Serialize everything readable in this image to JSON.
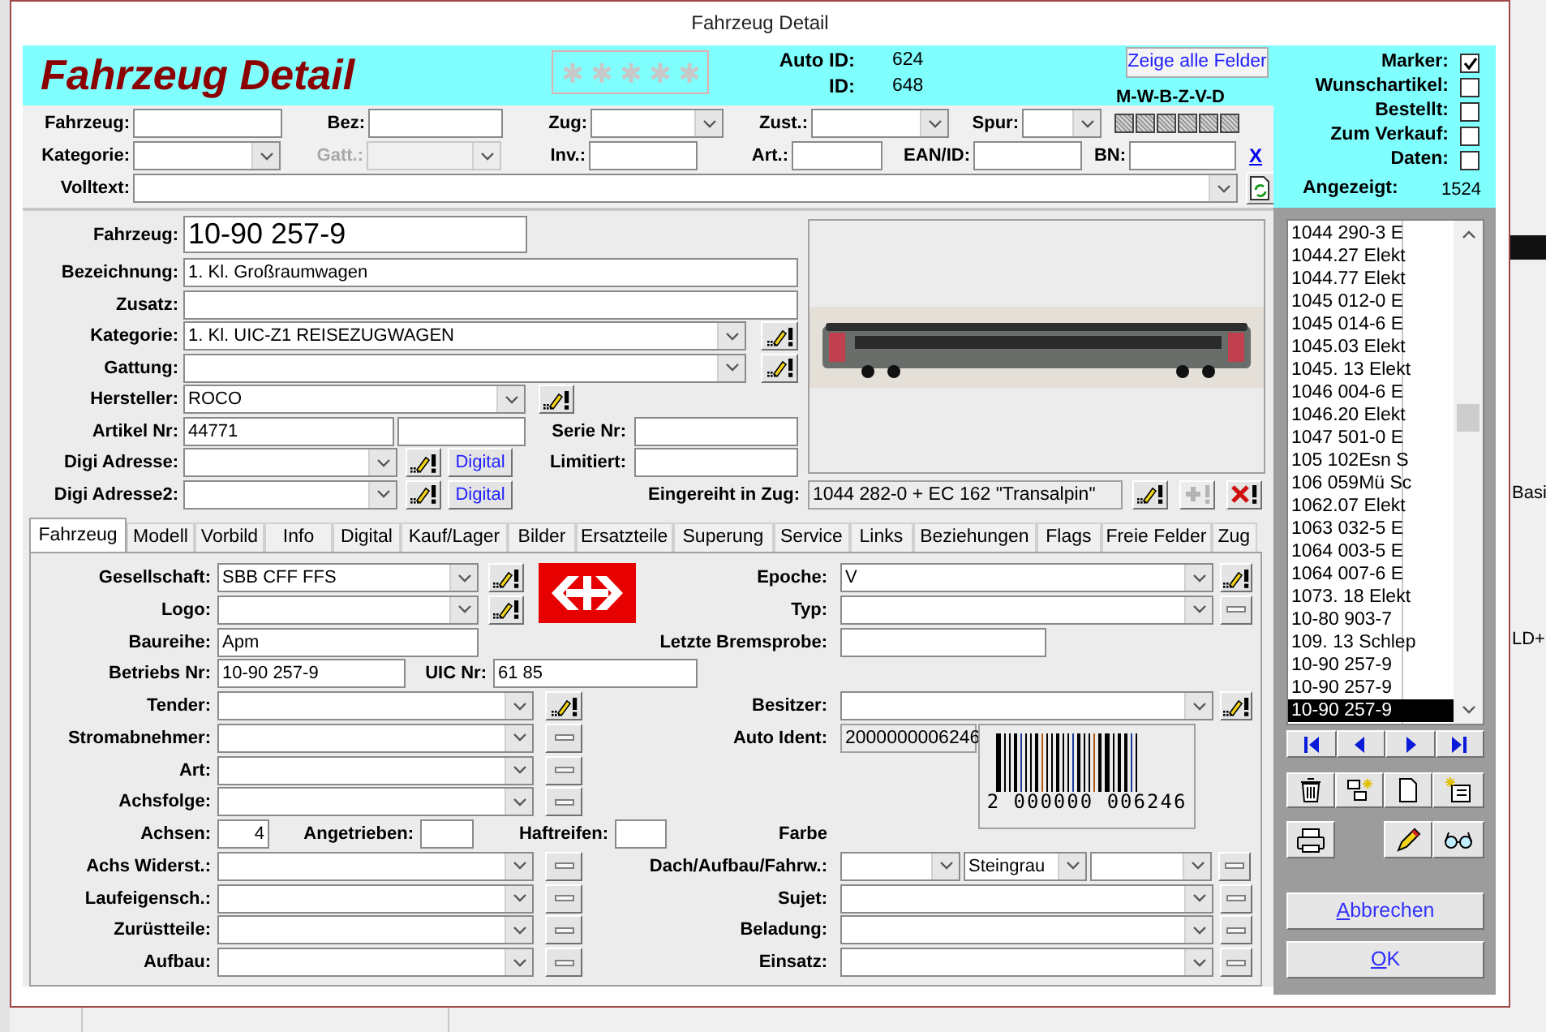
{
  "window": {
    "title": "Fahrzeug Detail"
  },
  "header": {
    "title": "Fahrzeug Detail",
    "stars": 0,
    "ids": [
      {
        "label": "Auto ID:",
        "value": "624"
      },
      {
        "label": "ID:",
        "value": "648"
      }
    ],
    "show_all_button": "Zeige alle Felder",
    "legend": "M-W-B-Z-V-D"
  },
  "filters": [
    [
      {
        "kind": "field",
        "label": "Fahrzeug:",
        "controls": [
          {
            "kind": "text"
          }
        ],
        "disabled": false
      },
      {
        "kind": "field",
        "label": "Bez:",
        "controls": [
          {
            "kind": "text"
          }
        ],
        "disabled": false
      },
      {
        "kind": "field",
        "label": "Zug:",
        "controls": [
          {
            "kind": "select"
          }
        ],
        "disabled": false
      },
      {
        "kind": "field",
        "label": "Zust.:",
        "controls": [
          {
            "kind": "select"
          }
        ],
        "disabled": false
      },
      {
        "kind": "field",
        "label": "Spur:",
        "controls": [
          {
            "kind": "select"
          }
        ],
        "disabled": false
      },
      {
        "kind": "boxes",
        "items": [
          {
            "indeterminate": true
          },
          {
            "indeterminate": true
          },
          {
            "indeterminate": true
          },
          {
            "indeterminate": true
          },
          {
            "indeterminate": true
          },
          {
            "indeterminate": true
          }
        ]
      }
    ],
    [
      {
        "kind": "field",
        "label": "Kategorie:",
        "controls": [
          {
            "kind": "select"
          }
        ],
        "disabled": false
      },
      {
        "kind": "field",
        "label": "Gatt.:",
        "controls": [
          {
            "kind": "select"
          }
        ],
        "disabled": true
      },
      {
        "kind": "field",
        "label": "Inv.:",
        "controls": [
          {
            "kind": "text"
          }
        ],
        "disabled": false
      },
      {
        "kind": "field",
        "label": "Art.:",
        "controls": [
          {
            "kind": "text"
          }
        ],
        "disabled": false
      },
      {
        "kind": "field",
        "label": "EAN/ID:",
        "controls": [
          {
            "kind": "text"
          }
        ],
        "disabled": false
      },
      {
        "kind": "field",
        "label": "BN:",
        "controls": [
          {
            "kind": "text"
          }
        ],
        "disabled": false
      },
      {
        "kind": "link",
        "text": "X"
      }
    ],
    [
      {
        "kind": "field",
        "label": "Volltext:",
        "controls": [
          {
            "kind": "select"
          }
        ],
        "disabled": false
      },
      {
        "kind": "refresh"
      }
    ]
  ],
  "flags": [
    {
      "label": "Marker:",
      "checked": true
    },
    {
      "label": "Wunschartikel:",
      "checked": false
    },
    {
      "label": "Bestellt:",
      "checked": false
    },
    {
      "label": "Zum Verkauf:",
      "checked": false
    },
    {
      "label": "Daten:",
      "checked": false
    }
  ],
  "displayed": {
    "label": "Angezeigt:",
    "value": "1524"
  },
  "record": [
    [
      {
        "kind": "field",
        "label": "Fahrzeug:",
        "controls": [
          {
            "kind": "text",
            "value": "10-90 257-9"
          }
        ]
      }
    ],
    [
      {
        "kind": "field",
        "label": "Bezeichnung:",
        "controls": [
          {
            "kind": "text",
            "value": "1. Kl. Großraumwagen"
          }
        ]
      }
    ],
    [
      {
        "kind": "field",
        "label": "Zusatz:",
        "controls": [
          {
            "kind": "text"
          }
        ]
      }
    ],
    [
      {
        "kind": "field",
        "label": "Kategorie:",
        "controls": [
          {
            "kind": "select",
            "value": "1. Kl. UIC-Z1 REISEZUGWAGEN"
          }
        ],
        "buttons": [
          {
            "kind": "edit"
          }
        ]
      }
    ],
    [
      {
        "kind": "field",
        "label": "Gattung:",
        "controls": [
          {
            "kind": "select"
          }
        ],
        "buttons": [
          {
            "kind": "edit"
          }
        ]
      }
    ],
    [
      {
        "kind": "field",
        "label": "Hersteller:",
        "controls": [
          {
            "kind": "select",
            "value": "ROCO"
          }
        ],
        "buttons": [
          {
            "kind": "edit"
          }
        ]
      }
    ],
    [
      {
        "kind": "field",
        "label": "Artikel Nr:",
        "controls": [
          {
            "kind": "text",
            "value": "44771"
          },
          {
            "kind": "text"
          }
        ]
      },
      {
        "kind": "field",
        "label": "Serie Nr:",
        "controls": [
          {
            "kind": "text"
          }
        ]
      }
    ],
    [
      {
        "kind": "field",
        "label": "Digi Adresse:",
        "controls": [
          {
            "kind": "select"
          }
        ],
        "buttons": [
          {
            "kind": "edit"
          },
          {
            "kind": "text",
            "label": "Digital"
          }
        ]
      },
      {
        "kind": "field",
        "label": "Limitiert:",
        "controls": [
          {
            "kind": "text"
          }
        ]
      }
    ],
    [
      {
        "kind": "field",
        "label": "Digi Adresse2:",
        "controls": [
          {
            "kind": "select"
          }
        ],
        "buttons": [
          {
            "kind": "edit"
          },
          {
            "kind": "text",
            "label": "Digital"
          }
        ]
      },
      {
        "kind": "field",
        "label": "Eingereiht in Zug:",
        "controls": [
          {
            "kind": "readonly",
            "value": "1044 282-0 + EC 162 \"Transalpin\""
          }
        ],
        "buttons": [
          {
            "kind": "edit",
            "disabled": false
          },
          {
            "kind": "add",
            "disabled": true
          },
          {
            "kind": "delete",
            "disabled": false
          }
        ]
      }
    ]
  ],
  "tabs": [
    {
      "label": "Fahrzeug",
      "selected": true
    },
    {
      "label": "Modell",
      "selected": false
    },
    {
      "label": "Vorbild",
      "selected": false
    },
    {
      "label": "Info",
      "selected": false
    },
    {
      "label": "Digital",
      "selected": false
    },
    {
      "label": "Kauf/Lager",
      "selected": false
    },
    {
      "label": "Bilder",
      "selected": false
    },
    {
      "label": "Ersatzteile",
      "selected": false
    },
    {
      "label": "Superung",
      "selected": false
    },
    {
      "label": "Service",
      "selected": false
    },
    {
      "label": "Links",
      "selected": false
    },
    {
      "label": "Beziehungen",
      "selected": false
    },
    {
      "label": "Flags",
      "selected": false
    },
    {
      "label": "Freie Felder",
      "selected": false
    },
    {
      "label": "Zug",
      "selected": false
    }
  ],
  "tab_content": [
    {
      "left": [
        {
          "kind": "field",
          "label": "Gesellschaft:",
          "controls": [
            {
              "kind": "select",
              "value": "SBB CFF FFS"
            }
          ],
          "buttons": [
            {
              "kind": "edit"
            }
          ]
        },
        {
          "kind": "logo"
        }
      ],
      "right": [
        {
          "kind": "field",
          "label": "Epoche:",
          "controls": [
            {
              "kind": "select",
              "value": "V"
            }
          ],
          "buttons": [
            {
              "kind": "edit"
            }
          ]
        }
      ]
    },
    {
      "left": [
        {
          "kind": "field",
          "label": "Logo:",
          "controls": [
            {
              "kind": "select"
            }
          ],
          "buttons": [
            {
              "kind": "edit"
            }
          ]
        }
      ],
      "right": [
        {
          "kind": "field",
          "label": "Typ:",
          "controls": [
            {
              "kind": "select"
            }
          ],
          "buttons": [
            {
              "kind": "plain"
            }
          ]
        }
      ]
    },
    {
      "left": [
        {
          "kind": "field",
          "label": "Baureihe:",
          "controls": [
            {
              "kind": "text",
              "value": "Apm"
            }
          ]
        }
      ],
      "right": [
        {
          "kind": "field",
          "label": "Letzte Bremsprobe:",
          "controls": [
            {
              "kind": "text"
            }
          ]
        }
      ]
    },
    {
      "left": [
        {
          "kind": "field",
          "label": "Betriebs Nr:",
          "controls": [
            {
              "kind": "text",
              "value": "10-90 257-9"
            }
          ]
        },
        {
          "kind": "field",
          "label": "UIC Nr:",
          "controls": [
            {
              "kind": "text",
              "value": "61 85"
            }
          ]
        }
      ]
    },
    {
      "left": [
        {
          "kind": "field",
          "label": "Tender:",
          "controls": [
            {
              "kind": "select"
            }
          ],
          "buttons": [
            {
              "kind": "edit"
            }
          ]
        }
      ],
      "right": [
        {
          "kind": "field",
          "label": "Besitzer:",
          "controls": [
            {
              "kind": "select"
            }
          ],
          "buttons": [
            {
              "kind": "edit"
            }
          ]
        }
      ]
    },
    {
      "left": [
        {
          "kind": "field",
          "label": "Stromabnehmer:",
          "controls": [
            {
              "kind": "select"
            }
          ],
          "buttons": [
            {
              "kind": "plain"
            }
          ]
        }
      ],
      "right": [
        {
          "kind": "field",
          "label": "Auto Ident:",
          "controls": [
            {
              "kind": "readonly",
              "value": "2000000006246"
            }
          ]
        },
        {
          "kind": "barcode",
          "text": "2 000000 006246"
        }
      ]
    },
    {
      "left": [
        {
          "kind": "field",
          "label": "Art:",
          "controls": [
            {
              "kind": "select"
            }
          ],
          "buttons": [
            {
              "kind": "plain"
            }
          ]
        }
      ]
    },
    {
      "left": [
        {
          "kind": "field",
          "label": "Achsfolge:",
          "controls": [
            {
              "kind": "select"
            }
          ],
          "buttons": [
            {
              "kind": "plain"
            }
          ]
        }
      ]
    },
    {
      "left": [
        {
          "kind": "field",
          "label": "Achsen:",
          "controls": [
            {
              "kind": "text",
              "value": "4"
            }
          ]
        },
        {
          "kind": "field",
          "label": "Angetrieben:",
          "controls": [
            {
              "kind": "text"
            }
          ]
        },
        {
          "kind": "field",
          "label": "Haftreifen:",
          "controls": [
            {
              "kind": "text"
            }
          ]
        }
      ],
      "right": [
        {
          "kind": "field",
          "label": "Farbe"
        }
      ]
    },
    {
      "left": [
        {
          "kind": "field",
          "label": "Achs Widerst.:",
          "controls": [
            {
              "kind": "select"
            }
          ],
          "buttons": [
            {
              "kind": "plain"
            }
          ]
        }
      ],
      "right": [
        {
          "kind": "field",
          "label": "Dach/Aufbau/Fahrw.:",
          "controls": [
            {
              "kind": "select"
            },
            {
              "kind": "select",
              "value": "Steingrau"
            },
            {
              "kind": "select"
            }
          ],
          "buttons": [
            {
              "kind": "plain"
            }
          ]
        }
      ]
    },
    {
      "left": [
        {
          "kind": "field",
          "label": "Laufeigensch.:",
          "controls": [
            {
              "kind": "select"
            }
          ],
          "buttons": [
            {
              "kind": "plain"
            }
          ]
        }
      ],
      "right": [
        {
          "kind": "field",
          "label": "Sujet:",
          "controls": [
            {
              "kind": "select"
            }
          ],
          "buttons": [
            {
              "kind": "plain"
            }
          ]
        }
      ]
    },
    {
      "left": [
        {
          "kind": "field",
          "label": "Zurüstteile:",
          "controls": [
            {
              "kind": "select"
            }
          ],
          "buttons": [
            {
              "kind": "plain"
            }
          ]
        }
      ],
      "right": [
        {
          "kind": "field",
          "label": "Beladung:",
          "controls": [
            {
              "kind": "select"
            }
          ],
          "buttons": [
            {
              "kind": "plain"
            }
          ]
        }
      ]
    },
    {
      "left": [
        {
          "kind": "field",
          "label": "Aufbau:",
          "controls": [
            {
              "kind": "select"
            }
          ],
          "buttons": [
            {
              "kind": "plain"
            }
          ]
        }
      ],
      "right": [
        {
          "kind": "field",
          "label": "Einsatz:",
          "controls": [
            {
              "kind": "select"
            }
          ],
          "buttons": [
            {
              "kind": "plain"
            }
          ]
        }
      ]
    }
  ],
  "list": [
    {
      "text": "1044 290-3 E",
      "selected": false
    },
    {
      "text": "1044.27 Elekt",
      "selected": false
    },
    {
      "text": "1044.77 Elekt",
      "selected": false
    },
    {
      "text": "1045 012-0 E",
      "selected": false
    },
    {
      "text": "1045 014-6 E",
      "selected": false
    },
    {
      "text": "1045.03 Elekt",
      "selected": false
    },
    {
      "text": "1045. 13 Elekt",
      "selected": false
    },
    {
      "text": "1046 004-6 E",
      "selected": false
    },
    {
      "text": "1046.20 Elekt",
      "selected": false
    },
    {
      "text": "1047 501-0 E",
      "selected": false
    },
    {
      "text": "105 102Esn S",
      "selected": false
    },
    {
      "text": "106 059Mü Sc",
      "selected": false
    },
    {
      "text": "1062.07 Elekt",
      "selected": false
    },
    {
      "text": "1063 032-5 E",
      "selected": false
    },
    {
      "text": "1064 003-5 E",
      "selected": false
    },
    {
      "text": "1064 007-6 E",
      "selected": false
    },
    {
      "text": "1073. 18 Elekt",
      "selected": false
    },
    {
      "text": "10-80 903-7",
      "selected": false
    },
    {
      "text": "109. 13 Schlep",
      "selected": false
    },
    {
      "text": "10-90 257-9",
      "selected": false
    },
    {
      "text": "10-90 257-9",
      "selected": false
    },
    {
      "text": "10-90 257-9",
      "selected": true
    }
  ],
  "dialog_buttons": [
    {
      "label": "Abbrechen"
    },
    {
      "label": "OK"
    }
  ],
  "background": [
    "Basi",
    "LD+"
  ]
}
